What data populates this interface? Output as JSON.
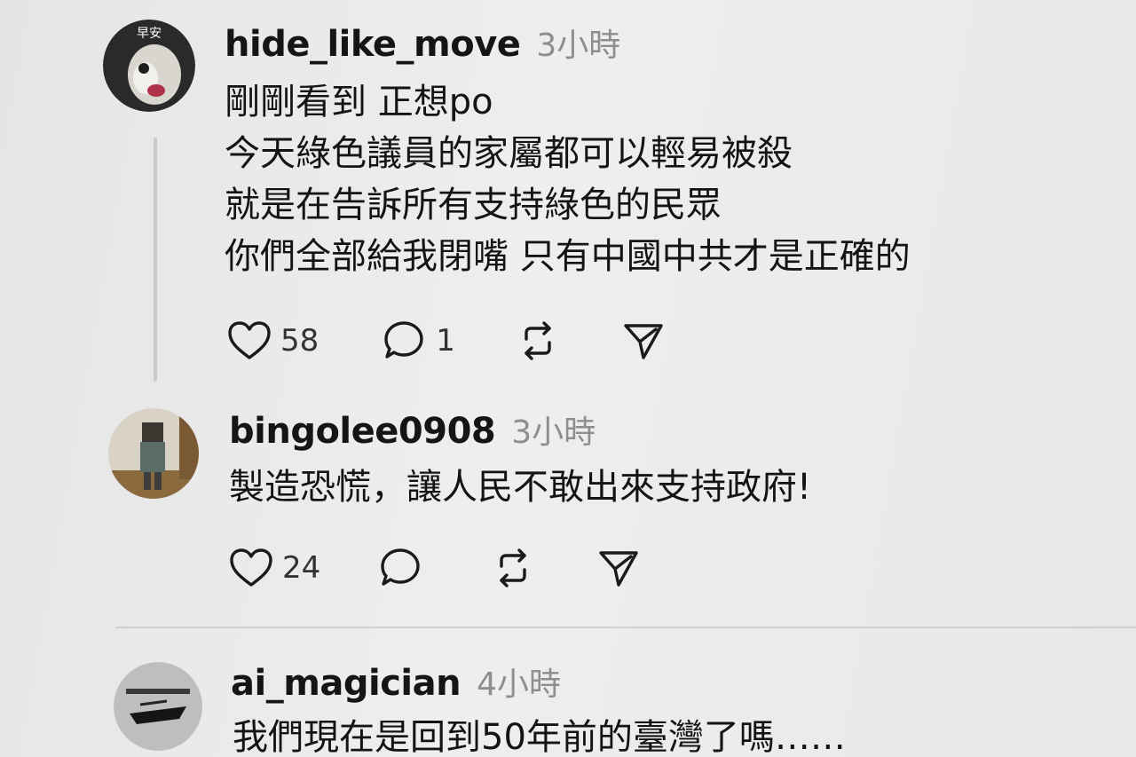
{
  "posts": [
    {
      "username": "hide_like_move",
      "time": "3小時",
      "avatar_text": "早安",
      "lines": [
        "剛剛看到 正想po",
        "今天綠色議員的家屬都可以輕易被殺",
        "就是在告訴所有支持綠色的民眾",
        "你們全部給我閉嘴 只有中國中共才是正確的"
      ],
      "likes": "58",
      "replies": "1"
    },
    {
      "username": "bingolee0908",
      "time": "3小時",
      "lines": [
        "製造恐慌，讓人民不敢出來支持政府!"
      ],
      "likes": "24",
      "replies": ""
    },
    {
      "username": "ai_magician",
      "time": "4小時",
      "lines": [
        "我們現在是回到50年前的臺灣了嗎……"
      ]
    }
  ],
  "icons": {
    "like": "heart-icon",
    "reply": "comment-icon",
    "repost": "repost-icon",
    "share": "send-icon"
  }
}
